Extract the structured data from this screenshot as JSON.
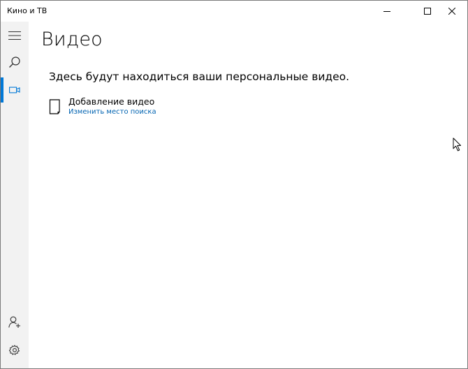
{
  "window": {
    "title": "Кино и ТВ"
  },
  "titlebar_buttons": {
    "minimize": "minimize-icon",
    "maximize": "maximize-icon",
    "close": "close-icon"
  },
  "sidebar": {
    "items": [
      {
        "icon": "hamburger-icon",
        "selected": false
      },
      {
        "icon": "search-icon",
        "selected": false
      },
      {
        "icon": "video-camera-icon",
        "selected": true
      },
      {
        "icon": "account-add-icon",
        "selected": false
      },
      {
        "icon": "gear-icon",
        "selected": false
      }
    ]
  },
  "main": {
    "title": "Видео",
    "empty_message": "Здесь будут находиться ваши персональные видео.",
    "add_video": {
      "label": "Добавление видео",
      "link": "Изменить место поиска",
      "icon": "document-icon"
    }
  },
  "colors": {
    "accent": "#0078d7",
    "link": "#0063b1",
    "sidebar_bg": "#f2f2f2"
  }
}
